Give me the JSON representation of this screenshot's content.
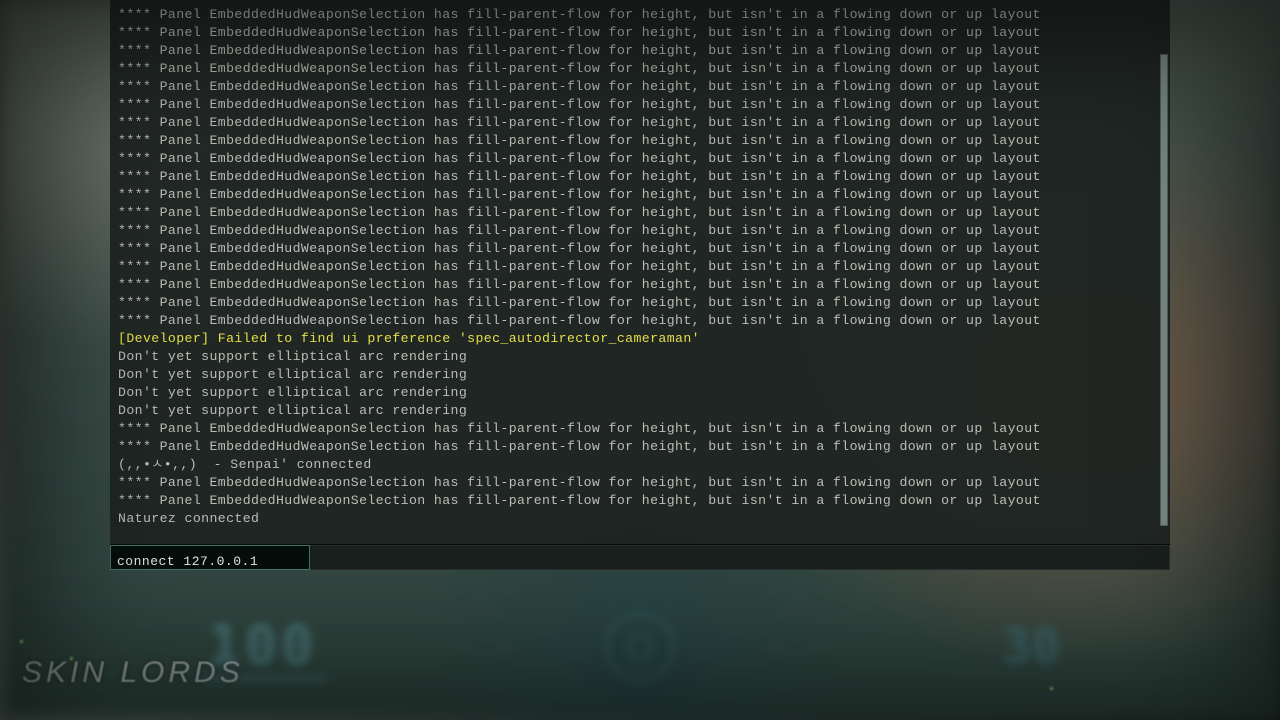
{
  "console": {
    "repeated_line": "**** Panel EmbeddedHudWeaponSelection has fill-parent-flow for height, but isn't in a flowing down or up layout",
    "dev_warn": "[Developer] Failed to find ui preference 'spec_autodirector_cameraman'",
    "arc_line": "Don't yet support elliptical arc rendering",
    "connected_1": "(,,•ㅅ•,,)  - Senpai' connected",
    "connected_2": "Naturez connected",
    "input_value": "connect 127.0.0.1"
  },
  "hud": {
    "health": "100",
    "ammo": "30"
  },
  "watermark": "SKIN LORDS"
}
